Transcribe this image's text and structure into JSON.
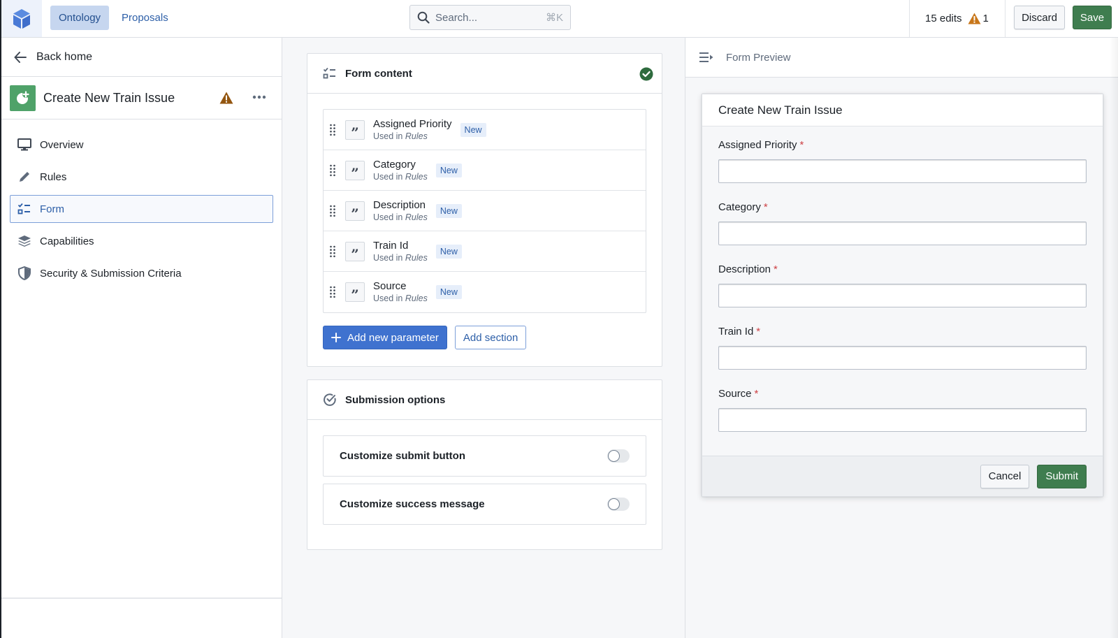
{
  "topbar": {
    "tabs": [
      {
        "label": "Ontology",
        "active": true
      },
      {
        "label": "Proposals",
        "active": false
      }
    ],
    "search": {
      "placeholder": "Search...",
      "shortcut": "⌘K"
    },
    "edits_label": "15 edits",
    "warning_count": "1",
    "discard_label": "Discard",
    "save_label": "Save"
  },
  "sidebar": {
    "back_label": "Back home",
    "action_title": "Create New Train Issue",
    "nav": [
      {
        "label": "Overview",
        "icon": "monitor-icon",
        "active": false
      },
      {
        "label": "Rules",
        "icon": "pencil-icon",
        "active": false
      },
      {
        "label": "Form",
        "icon": "form-checklist-icon",
        "active": true
      },
      {
        "label": "Capabilities",
        "icon": "layers-icon",
        "active": false
      },
      {
        "label": "Security & Submission Criteria",
        "icon": "shield-icon",
        "active": false
      }
    ]
  },
  "form_content": {
    "title": "Form content",
    "status": "valid",
    "parameters": [
      {
        "name": "Assigned Priority",
        "used_in_prefix": "Used in",
        "used_in": "Rules",
        "tag": "New"
      },
      {
        "name": "Category",
        "used_in_prefix": "Used in",
        "used_in": "Rules",
        "tag": "New"
      },
      {
        "name": "Description",
        "used_in_prefix": "Used in",
        "used_in": "Rules",
        "tag": "New"
      },
      {
        "name": "Train Id",
        "used_in_prefix": "Used in",
        "used_in": "Rules",
        "tag": "New"
      },
      {
        "name": "Source",
        "used_in_prefix": "Used in",
        "used_in": "Rules",
        "tag": "New"
      }
    ],
    "add_parameter_label": "Add new parameter",
    "add_section_label": "Add section"
  },
  "submission_options": {
    "title": "Submission options",
    "toggles": [
      {
        "label": "Customize submit button",
        "on": false
      },
      {
        "label": "Customize success message",
        "on": false
      }
    ]
  },
  "preview": {
    "header_label": "Form Preview",
    "dialog_title": "Create New Train Issue",
    "fields": [
      {
        "label": "Assigned Priority",
        "required": "*",
        "value": ""
      },
      {
        "label": "Category",
        "required": "*",
        "value": ""
      },
      {
        "label": "Description",
        "required": "*",
        "value": ""
      },
      {
        "label": "Train Id",
        "required": "*",
        "value": ""
      },
      {
        "label": "Source",
        "required": "*",
        "value": ""
      }
    ],
    "cancel_label": "Cancel",
    "submit_label": "Submit"
  },
  "colors": {
    "accent_blue": "#3f72cf",
    "success_green": "#3f7d4f",
    "warning_orange": "#c87619",
    "action_icon_green": "#4fa269"
  }
}
